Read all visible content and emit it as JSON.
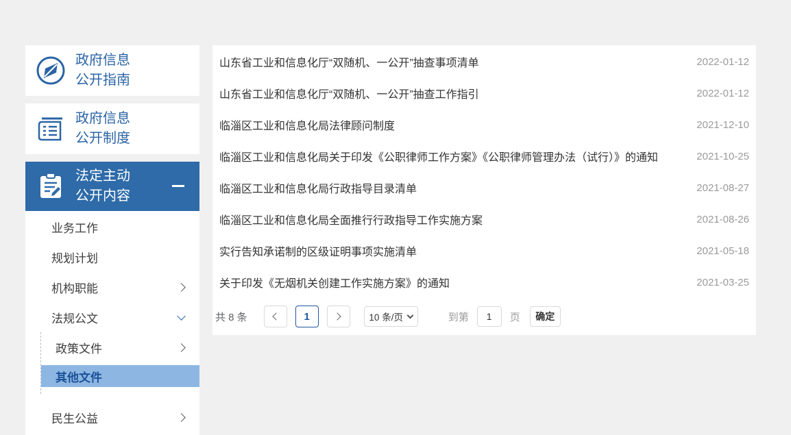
{
  "sidebar": {
    "card1": {
      "icon": "compass-icon",
      "line1": "政府信息",
      "line2": "公开指南"
    },
    "card2": {
      "icon": "notebook-icon",
      "line1": "政府信息",
      "line2": "公开制度"
    },
    "section": {
      "icon": "clipboard-pen-icon",
      "line1": "法定主动",
      "line2": "公开内容",
      "state": "expanded"
    },
    "items": [
      {
        "label": "业务工作"
      },
      {
        "label": "规划计划"
      },
      {
        "label": "机构职能"
      },
      {
        "label": "法规公文"
      }
    ],
    "subitems": [
      {
        "label": "政策文件"
      },
      {
        "label": "其他文件",
        "active": true
      }
    ],
    "items_after": [
      {
        "label": "民生公益"
      }
    ]
  },
  "list": {
    "items": [
      {
        "title": "山东省工业和信息化厅“双随机、一公开”抽查事项清单",
        "date": "2022-01-12"
      },
      {
        "title": "山东省工业和信息化厅“双随机、一公开”抽查工作指引",
        "date": "2022-01-12"
      },
      {
        "title": "临淄区工业和信息化局法律顾问制度",
        "date": "2021-12-10"
      },
      {
        "title": "临淄区工业和信息化局关于印发《公职律师工作方案》《公职律师管理办法（试行）》的通知",
        "date": "2021-10-25"
      },
      {
        "title": "临淄区工业和信息化局行政指导目录清单",
        "date": "2021-08-27"
      },
      {
        "title": "临淄区工业和信息化局全面推行行政指导工作实施方案",
        "date": "2021-08-26"
      },
      {
        "title": "实行告知承诺制的区级证明事项实施清单",
        "date": "2021-05-18"
      },
      {
        "title": "关于印发《无烟机关创建工作实施方案》的通知",
        "date": "2021-03-25"
      }
    ]
  },
  "pagination": {
    "total_label": "共 8 条",
    "current_page": "1",
    "page_size_label": "10 条/页",
    "goto_label": "到第",
    "goto_value": "1",
    "page_unit": "页",
    "confirm_label": "确定"
  },
  "colors": {
    "page_background": "#f0f0f0",
    "accent_blue": "#2b64a6",
    "section_header_bg": "#2e6ba8",
    "active_subitem_bg": "#8db7e2",
    "active_subitem_text": "#1b5199",
    "date_gray": "#9a9a9a",
    "active_page_blue": "#1e56a0"
  }
}
